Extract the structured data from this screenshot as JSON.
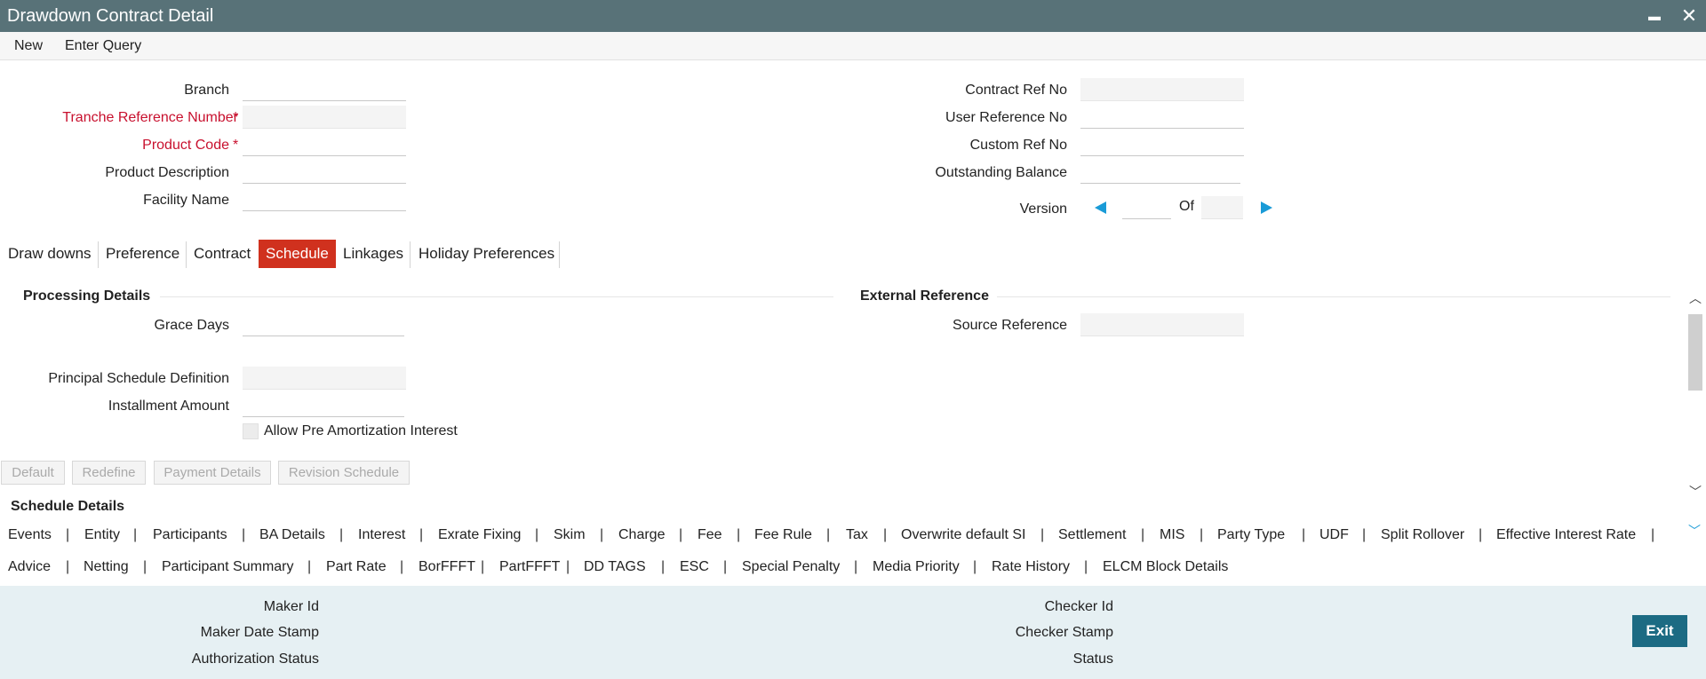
{
  "window": {
    "title": "Drawdown Contract Detail",
    "minimize": "▬",
    "close": "✕"
  },
  "menu": {
    "new": "New",
    "enter_query": "Enter Query"
  },
  "header_left": {
    "branch": "Branch",
    "tranche_ref": "Tranche Reference Number",
    "product_code": "Product Code",
    "product_desc": "Product Description",
    "facility_name": "Facility Name",
    "required_mark": "*"
  },
  "header_right": {
    "contract_ref": "Contract Ref No",
    "user_ref": "User Reference No",
    "custom_ref": "Custom Ref No",
    "outstanding": "Outstanding Balance",
    "version": "Version",
    "of": "Of"
  },
  "tabs": [
    "Draw downs",
    "Preference",
    "Contract",
    "Schedule",
    "Linkages",
    "Holiday Preferences"
  ],
  "processing": {
    "title": "Processing Details",
    "grace_days": "Grace Days",
    "principal_schedule": "Principal Schedule Definition",
    "installment_amount": "Installment Amount",
    "allow_pre_amort": "Allow Pre Amortization Interest"
  },
  "external": {
    "title": "External Reference",
    "source_ref": "Source Reference"
  },
  "schedule_buttons": [
    "Default",
    "Redefine",
    "Payment Details",
    "Revision Schedule"
  ],
  "schedule_details_title": "Schedule Details",
  "links_row1": [
    "Events",
    "Entity",
    "Participants",
    "BA Details",
    "Interest",
    "Exrate Fixing",
    "Skim",
    "Charge",
    "Fee",
    "Fee Rule",
    "Tax",
    "Overwrite default SI",
    "Settlement",
    "MIS",
    "Party Type",
    "UDF",
    "Split Rollover",
    "Effective Interest Rate"
  ],
  "links_row2": [
    "Advice",
    "Netting",
    "Participant Summary",
    "Part Rate",
    "BorFFFT",
    "PartFFFT",
    "DD TAGS",
    "ESC",
    "Special Penalty",
    "Media Priority",
    "Rate History",
    "ELCM Block Details"
  ],
  "pipe": "|",
  "footer": {
    "maker_id": "Maker Id",
    "maker_date": "Maker Date Stamp",
    "auth_status": "Authorization Status",
    "checker_id": "Checker Id",
    "checker_stamp": "Checker Stamp",
    "status": "Status",
    "exit": "Exit"
  },
  "colors": {
    "titlebar": "#587278",
    "active_tab": "#d0311e",
    "exit_button": "#1c6b83",
    "required": "#c8102e",
    "nav_arrow": "#1a9bd7",
    "footer_bg": "#e6f0f3"
  }
}
